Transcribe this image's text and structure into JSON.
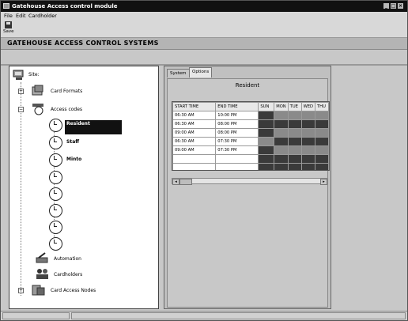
{
  "window": {
    "title": "Gatehouse Access control module"
  },
  "menu": {
    "file": "File",
    "edit": "Edit",
    "cardholder": "Cardholder"
  },
  "toolbar": {
    "save_label": "Save",
    "save_icon": "floppy-disk-icon"
  },
  "header": {
    "title": "GATEHOUSE ACCESS CONTROL SYSTEMS"
  },
  "tree": {
    "root": "Site:",
    "card_formats": "Card Formats",
    "access_codes": "Access codes",
    "codes": [
      "Resident",
      "Staff",
      "Minto"
    ],
    "automation": "Automation",
    "cardholders": "Cardholders",
    "card_access_nodes": "Card Access Nodes",
    "selected": "Resident"
  },
  "tabs": {
    "system": "System",
    "options": "Options",
    "active": "Options"
  },
  "schedule": {
    "title": "Resident",
    "columns": [
      "START TIME",
      "END TIME",
      "SUN",
      "MON",
      "TUE",
      "WED",
      "THU"
    ],
    "rows": [
      {
        "start": "06:30 AM",
        "end": "10:00 PM",
        "days": [
          1,
          0,
          0,
          0,
          0
        ]
      },
      {
        "start": "06:30 AM",
        "end": "08:00 PM",
        "days": [
          1,
          1,
          1,
          1,
          1
        ]
      },
      {
        "start": "09:00 AM",
        "end": "08:00 PM",
        "days": [
          1,
          0,
          0,
          0,
          0
        ]
      },
      {
        "start": "06:30 AM",
        "end": "07:30 PM",
        "days": [
          0,
          1,
          1,
          1,
          1
        ]
      },
      {
        "start": "09:00 AM",
        "end": "07:30 PM",
        "days": [
          1,
          0,
          0,
          0,
          0
        ]
      },
      {
        "start": "",
        "end": "",
        "days": [
          1,
          1,
          1,
          1,
          1
        ]
      },
      {
        "start": "",
        "end": "",
        "days": [
          1,
          1,
          1,
          1,
          1
        ]
      },
      {
        "start": "",
        "end": "",
        "days": [
          1,
          1,
          1,
          1,
          1
        ]
      }
    ],
    "colors": {
      "enabled": "#3a3a3a",
      "disabled": "#8a8a8a"
    }
  }
}
